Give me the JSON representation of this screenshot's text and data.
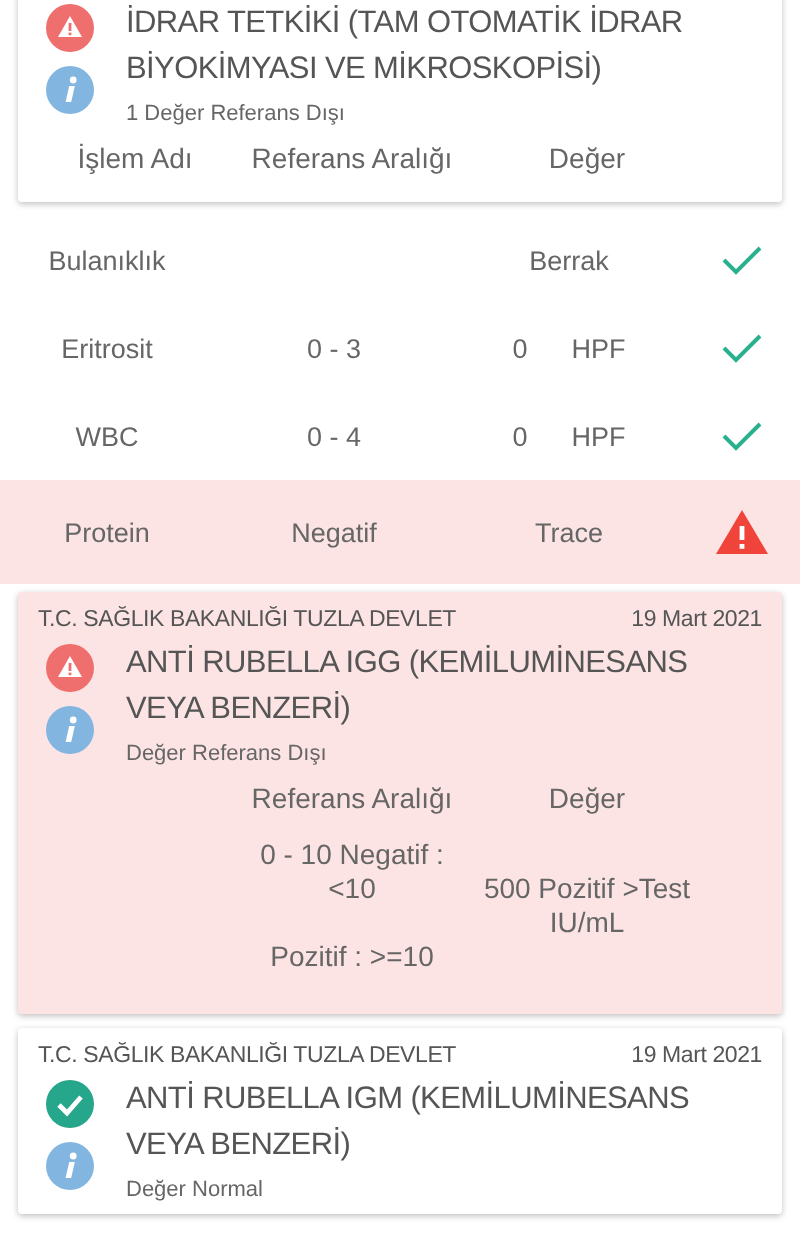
{
  "tests": [
    {
      "out_of_range": true,
      "highlighted": false,
      "title": "İDRAR TETKİKİ (TAM OTOMATİK İDRAR BİYOKİMYASI VE MİKROSKOPİSİ)",
      "summary": "1 Değer Referans Dışı",
      "columns": [
        {
          "kind": "name",
          "label": "İşlem Adı"
        },
        {
          "kind": "range",
          "label": "Referans Aralığı"
        },
        {
          "kind": "value",
          "label": "Değer"
        }
      ],
      "results": [
        {
          "name": "Bulanıklık",
          "value": "Berrak",
          "out_of_range": false
        },
        {
          "name": "Eritrosit",
          "range": "0 - 3",
          "value": "0",
          "unit": "HPF",
          "out_of_range": false
        },
        {
          "name": "WBC",
          "range": "0 - 4",
          "value": "0",
          "unit": "HPF",
          "out_of_range": false
        },
        {
          "name": "Protein",
          "range": "Negatif",
          "value": "Trace",
          "out_of_range": true
        }
      ]
    },
    {
      "out_of_range": true,
      "highlighted": true,
      "source": "T.C. SAĞLIK BAKANLIĞI TUZLA DEVLET",
      "date": "19 Mart 2021",
      "title": "ANTİ RUBELLA IGG (KEMİLUMİNESANS VEYA BENZERİ)",
      "summary": "Değer Referans Dışı",
      "columns": [
        {
          "kind": "range",
          "label": "Referans Aralığı"
        },
        {
          "kind": "value",
          "label": "Değer"
        }
      ],
      "inline_results": [
        {
          "range": "0 - 10 Negatif  :\n<10\n\nPozitif  : >=10",
          "value": "500 Pozitif >Test\nIU/mL"
        }
      ]
    },
    {
      "out_of_range": false,
      "highlighted": false,
      "source": "T.C. SAĞLIK BAKANLIĞI TUZLA DEVLET",
      "date": "19 Mart 2021",
      "title": "ANTİ RUBELLA IGM (KEMİLUMİNESANS VEYA BENZERİ)",
      "summary": "Değer Normal"
    }
  ]
}
